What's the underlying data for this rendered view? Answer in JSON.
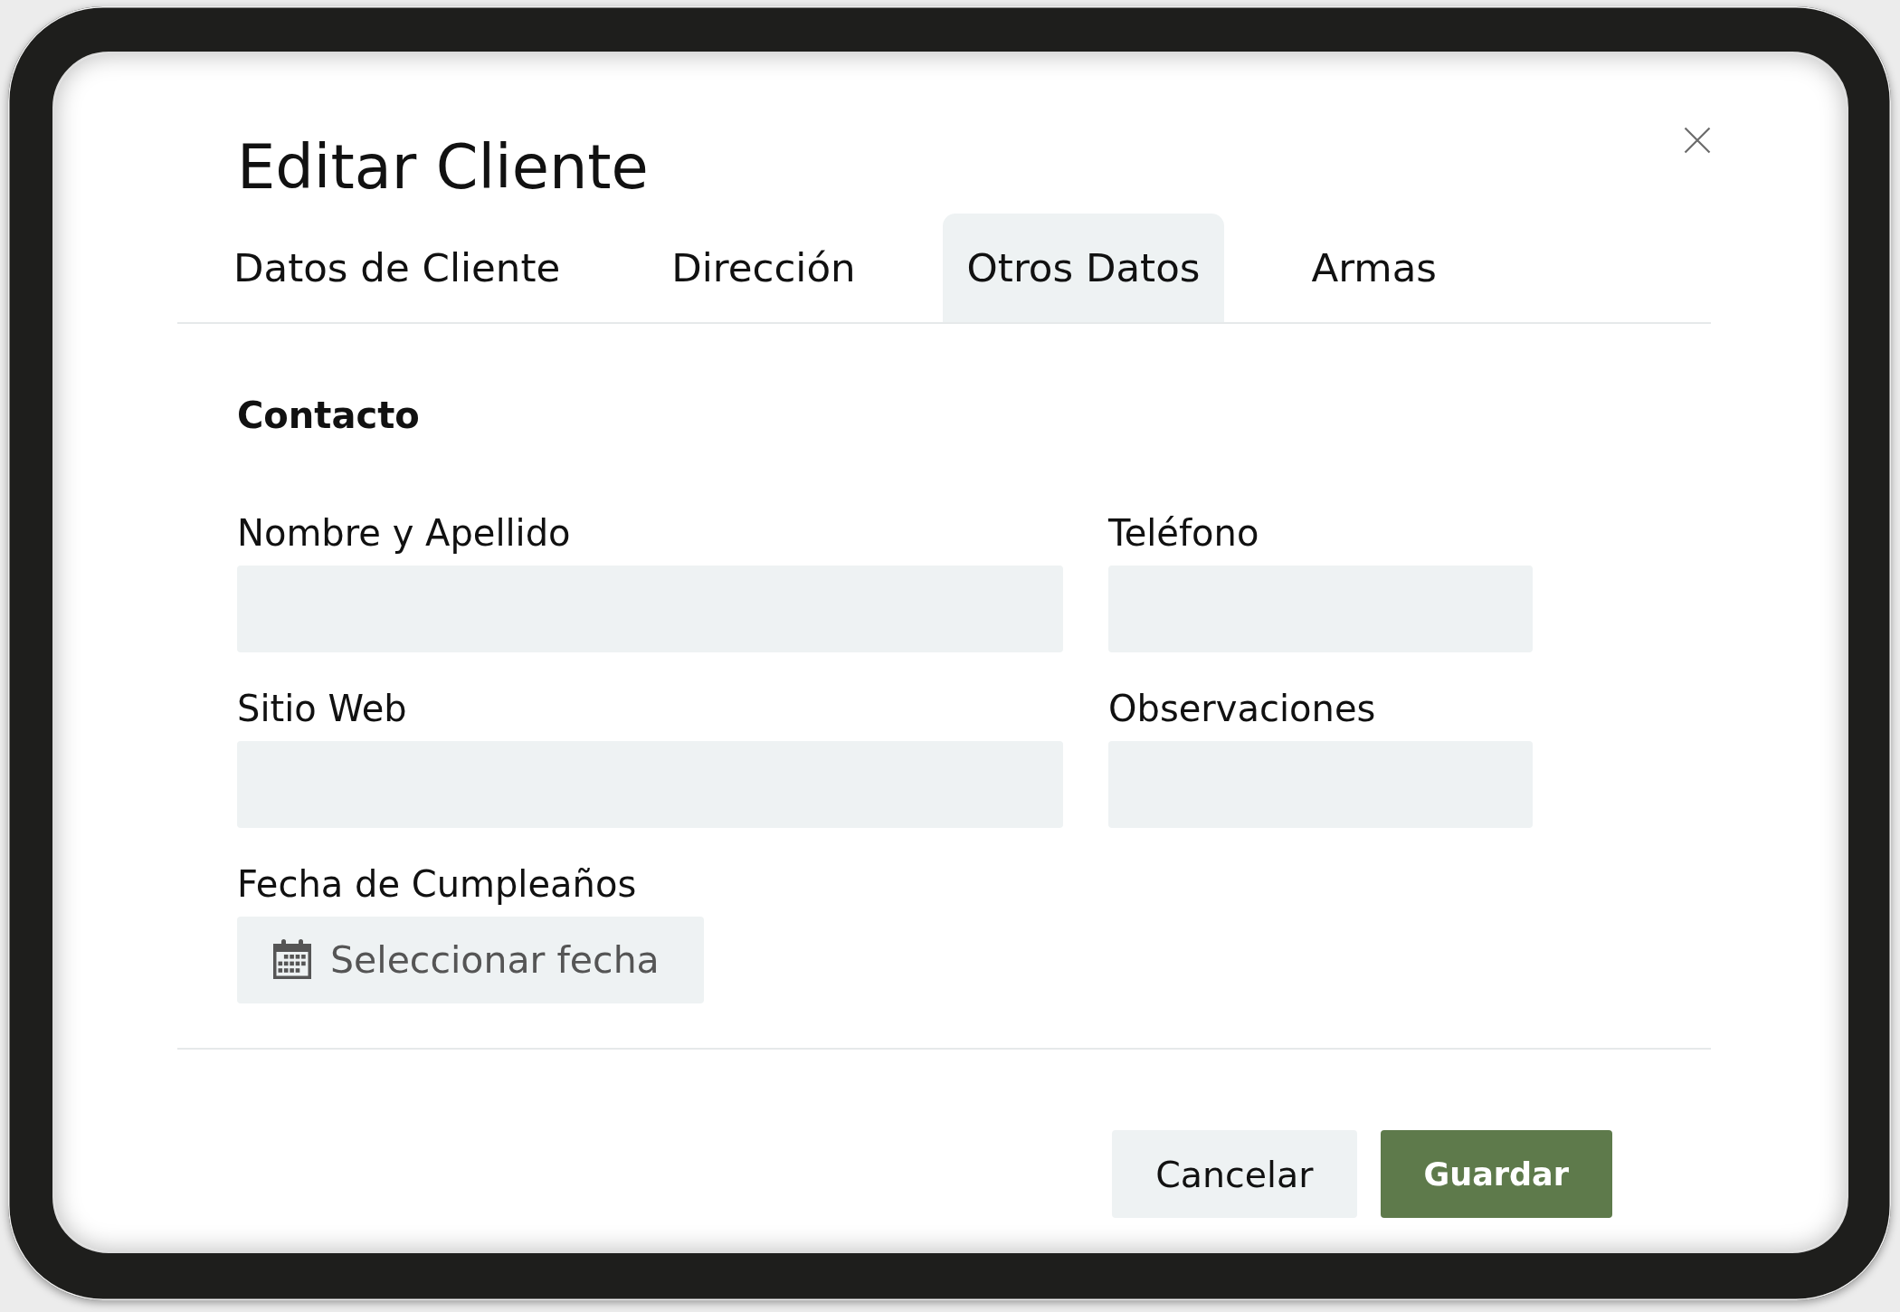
{
  "dialog": {
    "title": "Editar Cliente"
  },
  "tabs": [
    {
      "label": "Datos de Cliente",
      "selected": false
    },
    {
      "label": "Dirección",
      "selected": false
    },
    {
      "label": "Otros Datos",
      "selected": true
    },
    {
      "label": "Armas",
      "selected": false
    }
  ],
  "section": {
    "title": "Contacto"
  },
  "fields": [
    {
      "kind": "text",
      "label": "Nombre y Apellido"
    },
    {
      "kind": "text",
      "label": "Teléfono"
    },
    {
      "kind": "text",
      "label": "Sitio Web"
    },
    {
      "kind": "text",
      "label": "Observaciones"
    },
    {
      "kind": "date",
      "label": "Fecha de Cumpleaños",
      "placeholder": "Seleccionar fecha"
    }
  ],
  "buttons": [
    {
      "label": "Cancelar",
      "kind": "secondary"
    },
    {
      "label": "Guardar",
      "kind": "primary"
    }
  ]
}
